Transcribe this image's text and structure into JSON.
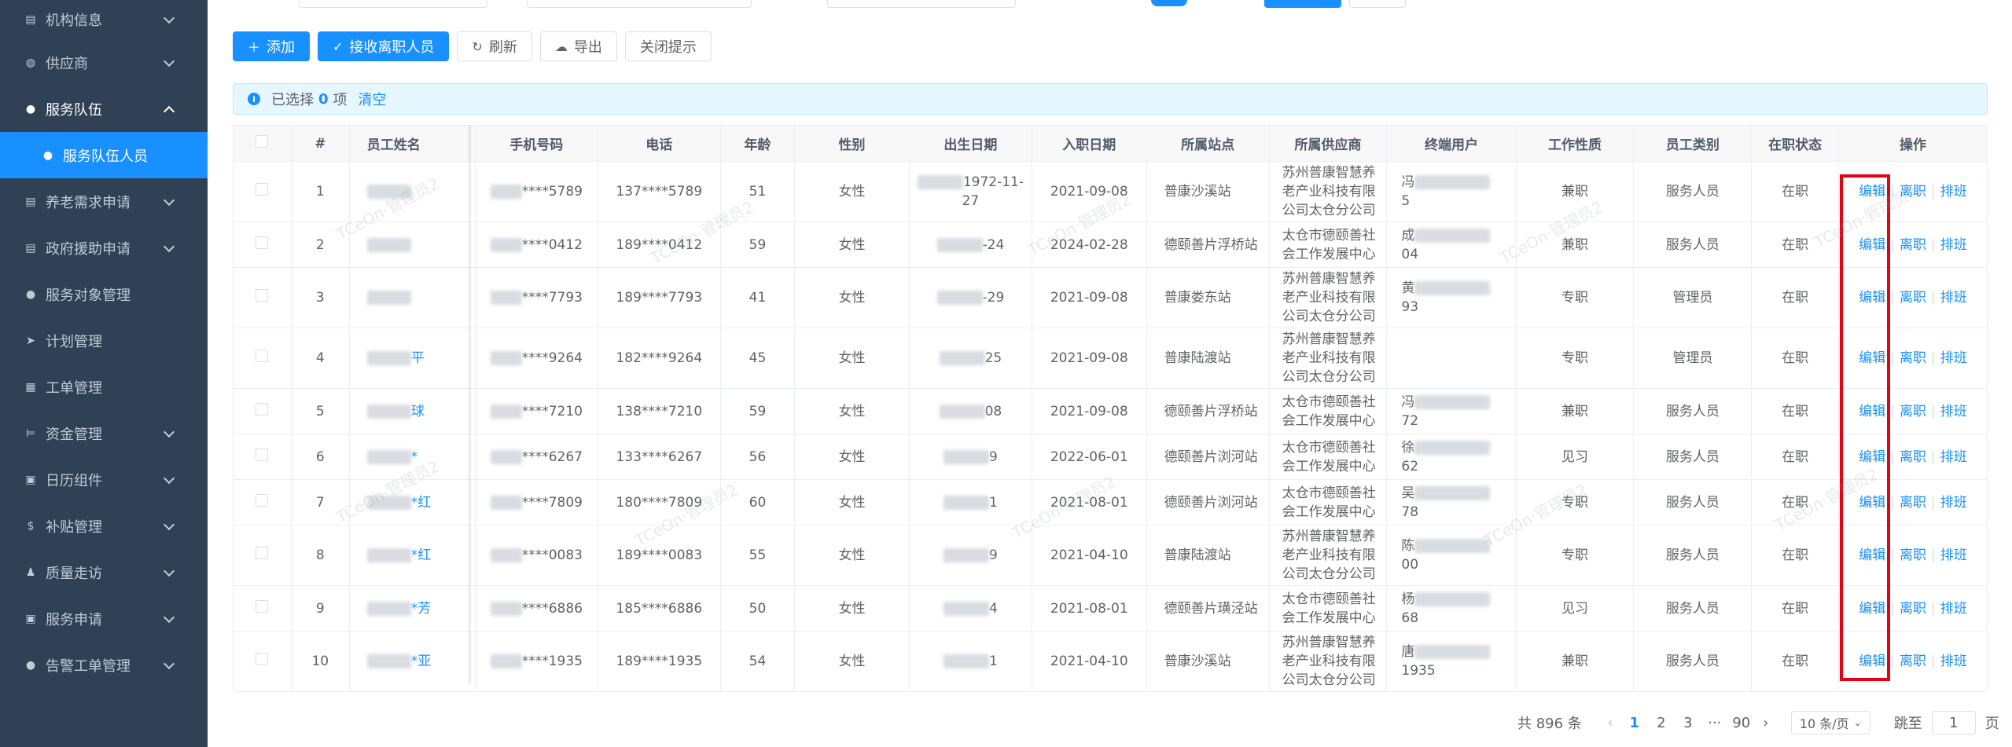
{
  "sidebar": {
    "items": [
      {
        "label": "机构信息",
        "icon": "doc-icon",
        "state": "collapsed"
      },
      {
        "label": "供应商",
        "icon": "globe-icon",
        "state": "collapsed"
      },
      {
        "label": "服务队伍",
        "icon": "team-icon",
        "state": "open"
      },
      {
        "label": "服务队伍人员",
        "icon": "user-icon",
        "state": "active-sub"
      },
      {
        "label": "养老需求申请",
        "icon": "doc-icon",
        "state": "collapsed"
      },
      {
        "label": "政府援助申请",
        "icon": "doc-icon",
        "state": "collapsed"
      },
      {
        "label": "服务对象管理",
        "icon": "user-icon",
        "state": "none"
      },
      {
        "label": "计划管理",
        "icon": "send-icon",
        "state": "none"
      },
      {
        "label": "工单管理",
        "icon": "list-icon",
        "state": "none"
      },
      {
        "label": "资金管理",
        "icon": "bed-icon",
        "state": "collapsed"
      },
      {
        "label": "日历组件",
        "icon": "calendar-icon",
        "state": "collapsed"
      },
      {
        "label": "补贴管理",
        "icon": "dollar-icon",
        "state": "collapsed"
      },
      {
        "label": "质量走访",
        "icon": "walk-icon",
        "state": "collapsed"
      },
      {
        "label": "服务申请",
        "icon": "calendar-icon",
        "state": "collapsed"
      },
      {
        "label": "告警工单管理",
        "icon": "alert-icon",
        "state": "collapsed"
      }
    ]
  },
  "toolbar": {
    "add": "添加",
    "receive": "接收离职人员",
    "refresh": "刷新",
    "export": "导出",
    "close_tip": "关闭提示"
  },
  "alert": {
    "prefix": "已选择",
    "count": "0",
    "suffix": "项",
    "clear": "清空"
  },
  "table": {
    "headers": [
      "#",
      "员工姓名",
      "手机号码",
      "电话",
      "年龄",
      "性别",
      "出生日期",
      "入职日期",
      "所属站点",
      "所属供应商",
      "终端用户",
      "工作性质",
      "员工类别",
      "在职状态",
      "操作"
    ],
    "ops": {
      "edit": "编辑",
      "resign": "离职",
      "schedule": "排班"
    },
    "rows": [
      {
        "idx": "1",
        "name": "",
        "mobile": "****5789",
        "phone": "137****5789",
        "age": "51",
        "gender": "女性",
        "birth": "1972-11-27",
        "hire": "2021-09-08",
        "site": "普康沙溪站",
        "vendor": [
          "苏州普康智慧养",
          "老产业科技有限",
          "公司太仓分公司"
        ],
        "enduser": [
          "冯",
          "5"
        ],
        "nature": "兼职",
        "category": "服务人员",
        "status": "在职"
      },
      {
        "idx": "2",
        "name": "",
        "mobile": "****0412",
        "phone": "189****0412",
        "age": "59",
        "gender": "女性",
        "birth": "-24",
        "hire": "2024-02-28",
        "site": "德颐善片浮桥站",
        "vendor": [
          "太仓市德颐善社",
          "会工作发展中心"
        ],
        "enduser": [
          "成",
          "04"
        ],
        "nature": "兼职",
        "category": "服务人员",
        "status": "在职"
      },
      {
        "idx": "3",
        "name": "",
        "mobile": "****7793",
        "phone": "189****7793",
        "age": "41",
        "gender": "女性",
        "birth": "-29",
        "hire": "2021-09-08",
        "site": "普康娄东站",
        "vendor": [
          "苏州普康智慧养",
          "老产业科技有限",
          "公司太仓分公司"
        ],
        "enduser": [
          "黄",
          "93"
        ],
        "nature": "专职",
        "category": "管理员",
        "status": "在职"
      },
      {
        "idx": "4",
        "name": "平",
        "mobile": "****9264",
        "phone": "182****9264",
        "age": "45",
        "gender": "女性",
        "birth": "25",
        "hire": "2021-09-08",
        "site": "普康陆渡站",
        "vendor": [
          "苏州普康智慧养",
          "老产业科技有限",
          "公司太仓分公司"
        ],
        "enduser": [
          "",
          ""
        ],
        "nature": "专职",
        "category": "管理员",
        "status": "在职"
      },
      {
        "idx": "5",
        "name": "球",
        "mobile": "****7210",
        "phone": "138****7210",
        "age": "59",
        "gender": "女性",
        "birth": "08",
        "hire": "2021-09-08",
        "site": "德颐善片浮桥站",
        "vendor": [
          "太仓市德颐善社",
          "会工作发展中心"
        ],
        "enduser": [
          "冯",
          "72"
        ],
        "nature": "兼职",
        "category": "服务人员",
        "status": "在职"
      },
      {
        "idx": "6",
        "name": "*",
        "mobile": "****6267",
        "phone": "133****6267",
        "age": "56",
        "gender": "女性",
        "birth": "9",
        "hire": "2022-06-01",
        "site": "德颐善片浏河站",
        "vendor": [
          "太仓市德颐善社",
          "会工作发展中心"
        ],
        "enduser": [
          "徐",
          "62"
        ],
        "nature": "见习",
        "category": "服务人员",
        "status": "在职"
      },
      {
        "idx": "7",
        "name": "*红",
        "mobile": "****7809",
        "phone": "180****7809",
        "age": "60",
        "gender": "女性",
        "birth": "1",
        "hire": "2021-08-01",
        "site": "德颐善片浏河站",
        "vendor": [
          "太仓市德颐善社",
          "会工作发展中心"
        ],
        "enduser": [
          "吴",
          "78"
        ],
        "nature": "专职",
        "category": "服务人员",
        "status": "在职"
      },
      {
        "idx": "8",
        "name": "*红",
        "mobile": "****0083",
        "phone": "189****0083",
        "age": "55",
        "gender": "女性",
        "birth": "9",
        "hire": "2021-04-10",
        "site": "普康陆渡站",
        "vendor": [
          "苏州普康智慧养",
          "老产业科技有限",
          "公司太仓分公司"
        ],
        "enduser": [
          "陈",
          "00"
        ],
        "nature": "专职",
        "category": "服务人员",
        "status": "在职"
      },
      {
        "idx": "9",
        "name": "*芳",
        "mobile": "****6886",
        "phone": "185****6886",
        "age": "50",
        "gender": "女性",
        "birth": "4",
        "hire": "2021-08-01",
        "site": "德颐善片璜泾站",
        "vendor": [
          "太仓市德颐善社",
          "会工作发展中心"
        ],
        "enduser": [
          "杨",
          "68"
        ],
        "nature": "见习",
        "category": "服务人员",
        "status": "在职"
      },
      {
        "idx": "10",
        "name": "*亚",
        "mobile": "****1935",
        "phone": "189****1935",
        "age": "54",
        "gender": "女性",
        "birth": "1",
        "hire": "2021-04-10",
        "site": "普康沙溪站",
        "vendor": [
          "苏州普康智慧养",
          "老产业科技有限",
          "公司太仓分公司"
        ],
        "enduser": [
          "唐",
          "1935"
        ],
        "nature": "兼职",
        "category": "服务人员",
        "status": "在职"
      }
    ]
  },
  "pager": {
    "total": "共 896 条",
    "pages": [
      "1",
      "2",
      "3",
      "···",
      "90"
    ],
    "current": "1",
    "page_size": "10 条/页",
    "jump_label": "跳至",
    "jump_value": "1",
    "jump_suffix": "页"
  },
  "colors": {
    "sidebar_bg": "#304156",
    "accent": "#1890ff",
    "highlight": "#e60012"
  }
}
